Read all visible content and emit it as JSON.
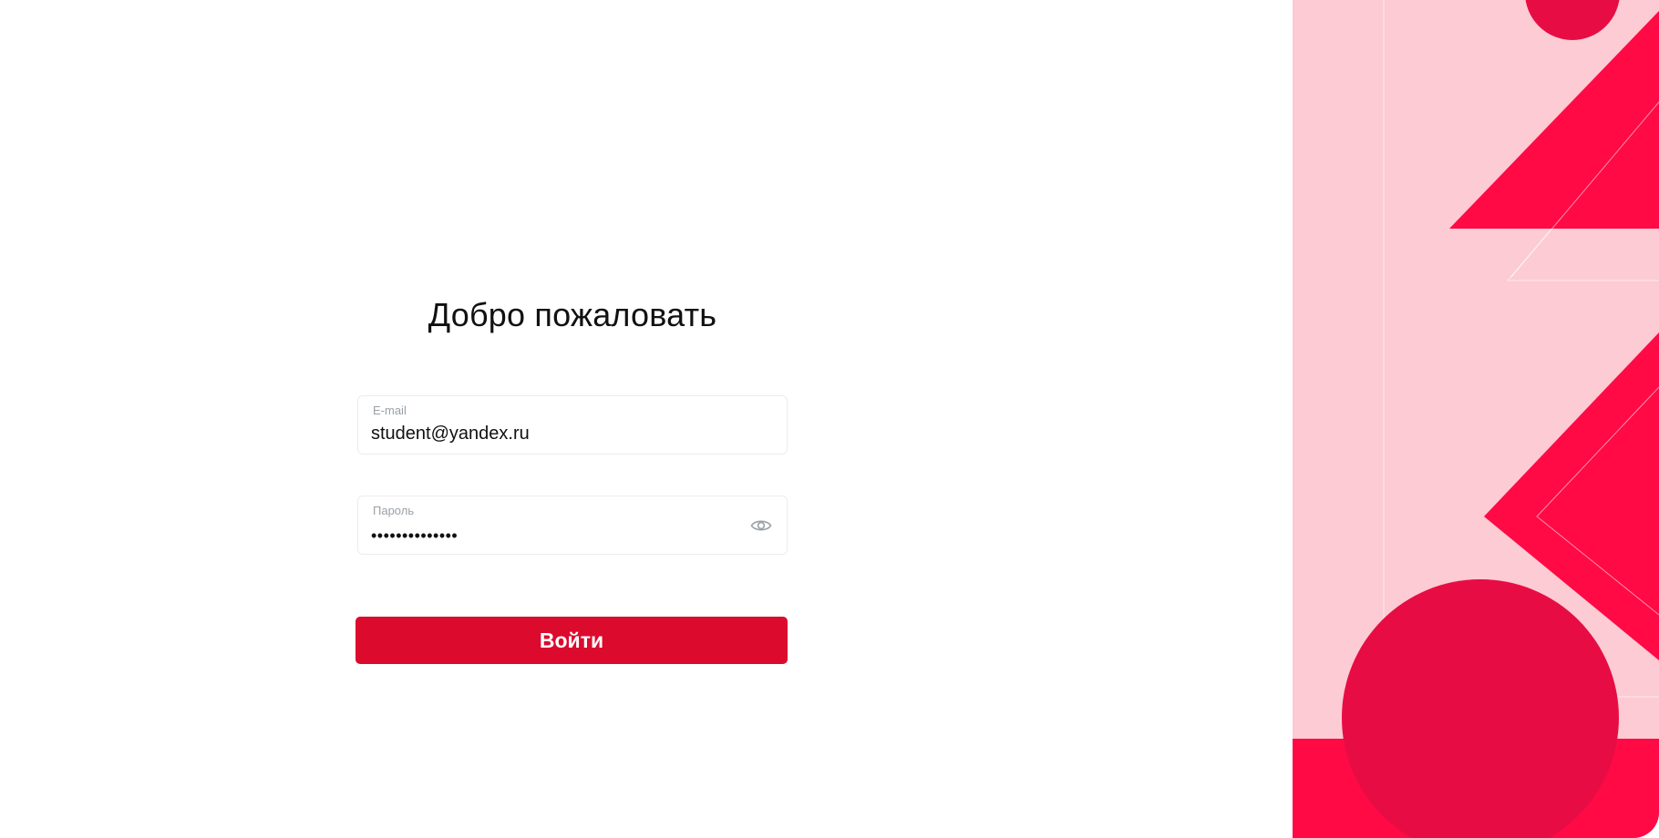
{
  "login": {
    "title": "Добро пожаловать",
    "email_label": "E-mail",
    "email_value": "student@yandex.ru",
    "password_label": "Пароль",
    "password_value": "••••••••••••••",
    "submit_label": "Войти"
  },
  "icons": {
    "password_toggle": "eye-icon"
  },
  "colors": {
    "accent": "#dc0a2d",
    "deco_background": "#fccbd3",
    "deco_shape_primary": "#ff0a45",
    "deco_shape_secondary": "#e80c45"
  }
}
